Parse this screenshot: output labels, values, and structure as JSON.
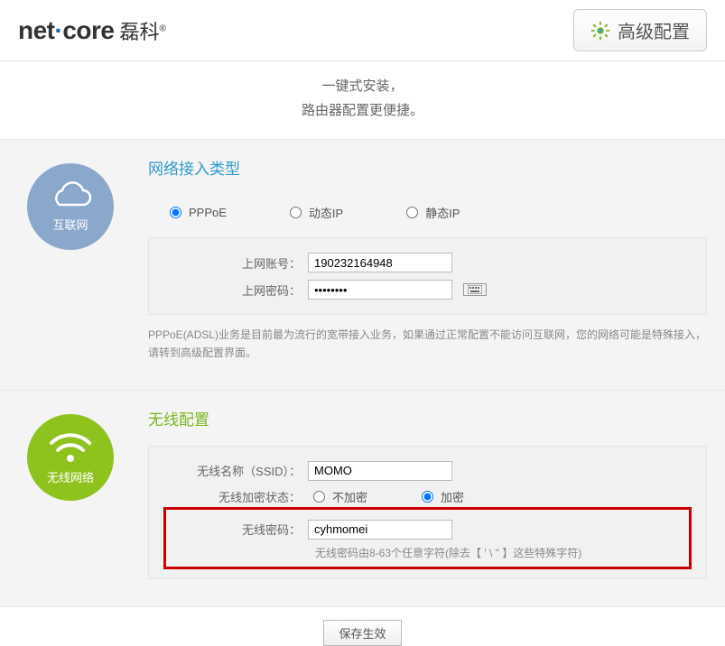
{
  "header": {
    "brand_en_1": "net",
    "brand_en_2": "core",
    "brand_cn": "磊科",
    "brand_sup": "®",
    "advanced_btn": "高级配置"
  },
  "tagline": {
    "line1": "一键式安装，",
    "line2": "路由器配置更便捷。"
  },
  "net": {
    "circle_label": "互联网",
    "title": "网络接入类型",
    "opt_pppoe": "PPPoE",
    "opt_dhcp": "动态IP",
    "opt_static": "静态IP",
    "label_account": "上网账号：",
    "account_value": "190232164948",
    "label_password": "上网密码：",
    "password_value": "••••••••",
    "help": "PPPoE(ADSL)业务是目前最为流行的宽带接入业务，如果通过正常配置不能访问互联网，您的网络可能是特殊接入，请转到高级配置界面。"
  },
  "wifi": {
    "circle_label": "无线网络",
    "title": "无线配置",
    "label_ssid": "无线名称（SSID）：",
    "ssid_value": "MOMO",
    "label_enc_state": "无线加密状态：",
    "opt_noenc": "不加密",
    "opt_enc": "加密",
    "label_password": "无线密码：",
    "password_value": "cyhmomei",
    "hint": "无线密码由8-63个任意字符(除去【 ' \\ \" 】这些特殊字符)"
  },
  "footer": {
    "save": "保存生效"
  }
}
